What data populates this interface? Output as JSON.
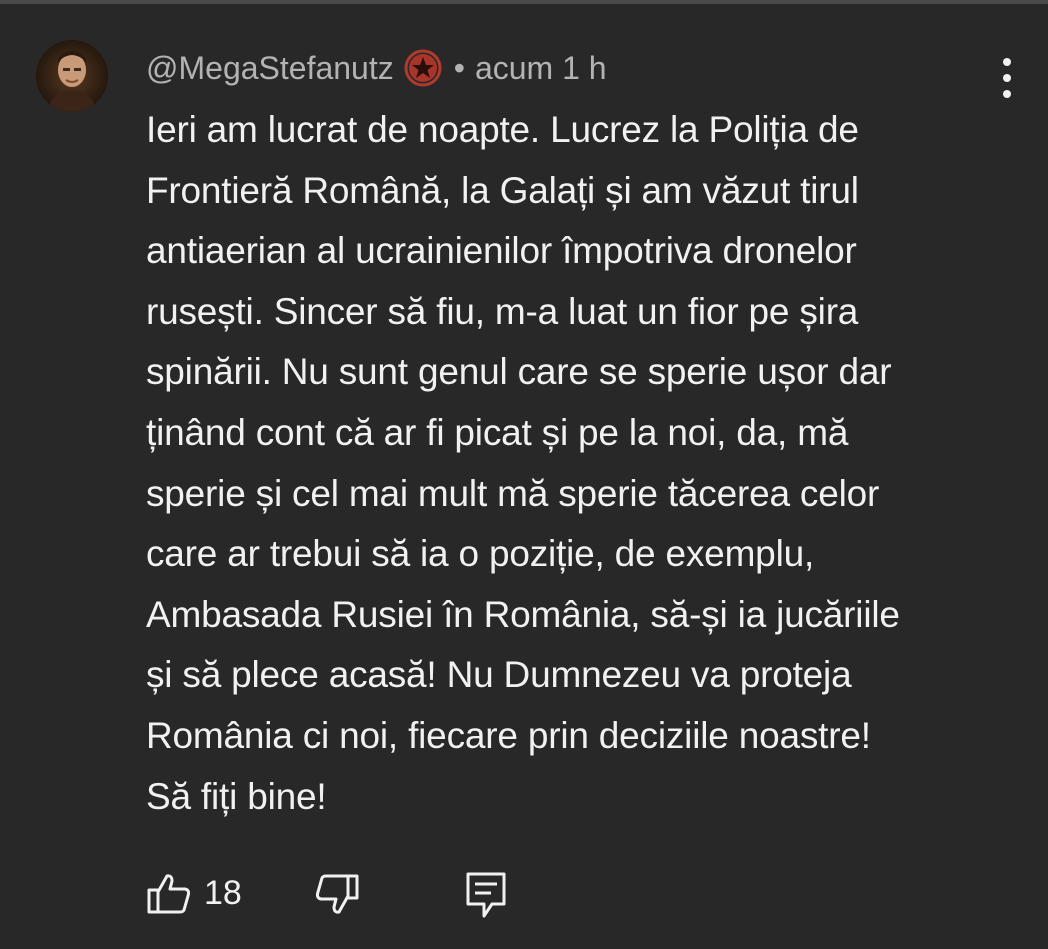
{
  "comment": {
    "author": "@MegaStefanutz",
    "separator": "•",
    "time": "acum 1 h",
    "text": "Ieri am lucrat de noapte. Lucrez la Poliția de\nFrontieră Română, la Galați și am văzut tirul\nantiaerian al ucrainienilor împotriva dronelor\nrusești. Sincer să fiu, m-a luat un fior pe șira\nspinării. Nu sunt genul care se sperie ușor dar\nținând cont că ar fi picat și pe la noi, da, mă\nsperie și cel mai mult mă sperie tăcerea celor\ncare ar trebui să ia o poziție, de exemplu,\nAmbasada Rusiei în România, să-și ia jucăriile\nși să plece acasă! Nu Dumnezeu va proteja\nRomânia ci noi, fiecare prin deciziile noastre!\nSă fiți bine!",
    "likes": "18"
  },
  "icons": {
    "badge": "red-star-badge-icon",
    "menu": "more-vertical-icon",
    "like": "thumbs-up-icon",
    "dislike": "thumbs-down-icon",
    "reply": "comment-reply-icon"
  },
  "colors": {
    "background": "#282828",
    "text": "#f1f1f1",
    "meta": "#b3b3b3",
    "badge": "#c0392b"
  }
}
